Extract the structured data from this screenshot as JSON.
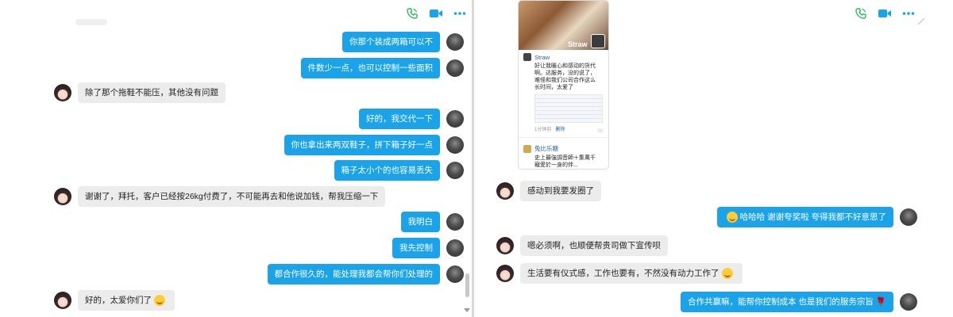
{
  "left_chat": {
    "messages": [
      {
        "side": "me",
        "text": "你那个装成两箱可以不"
      },
      {
        "side": "me",
        "text": "件数少一点，也可以控制一些面积"
      },
      {
        "side": "other",
        "text": "除了那个拖鞋不能压，其他没有问题"
      },
      {
        "side": "me",
        "text": "好的，我交代一下"
      },
      {
        "side": "me",
        "text": "你也拿出来两双鞋子，拼下箱子好一点"
      },
      {
        "side": "me",
        "text": "箱子太小个的也容易丢失"
      },
      {
        "side": "other",
        "text": "谢谢了，拜托，客户已经按26kg付费了，不可能再去和他说加钱，帮我压缩一下"
      },
      {
        "side": "me",
        "text": "我明白"
      },
      {
        "side": "me",
        "text": "我先控制"
      },
      {
        "side": "me",
        "text": "都合作很久的，能处理我都会帮你们处理的"
      },
      {
        "side": "other",
        "text": "好的，太爱你们了"
      }
    ]
  },
  "right_chat": {
    "moments_card": {
      "photo_label": "Straw",
      "post1_name": "Straw",
      "post1_text": "好让我暖心和感动的货代\n啊。达服务，没的说了，\n难怪和我们公司合作这么\n长时间，太爱了",
      "post1_time": "1分钟前",
      "post1_delete": "删除",
      "post1_more": "··",
      "post2_name": "兔比乐糖",
      "post2_text": "史上最強調音師＋集萬千\n寵愛於一身的伴..."
    },
    "messages": [
      {
        "side": "other",
        "text": "感动到我要发圈了"
      },
      {
        "side": "me",
        "text": "哈哈哈 谢谢夸奖啦 夸得我都不好意思了"
      },
      {
        "side": "other",
        "text": "嗯必须啊，也顺便帮贵司做下宣传呗"
      },
      {
        "side": "other",
        "text": "生活要有仪式感，工作也要有，不然没有动力工作了"
      },
      {
        "side": "me",
        "text": "合作共赢嘛，能帮你控制成本 也是我们的服务宗旨"
      }
    ]
  },
  "icons": [
    "phone-call-icon",
    "video-call-icon",
    "more-options-icon"
  ],
  "colors": {
    "bubble_me": "#1aa3e8",
    "bubble_other": "#ececec",
    "icon_green": "#2dbb5d",
    "icon_blue": "#1aa3e8"
  }
}
